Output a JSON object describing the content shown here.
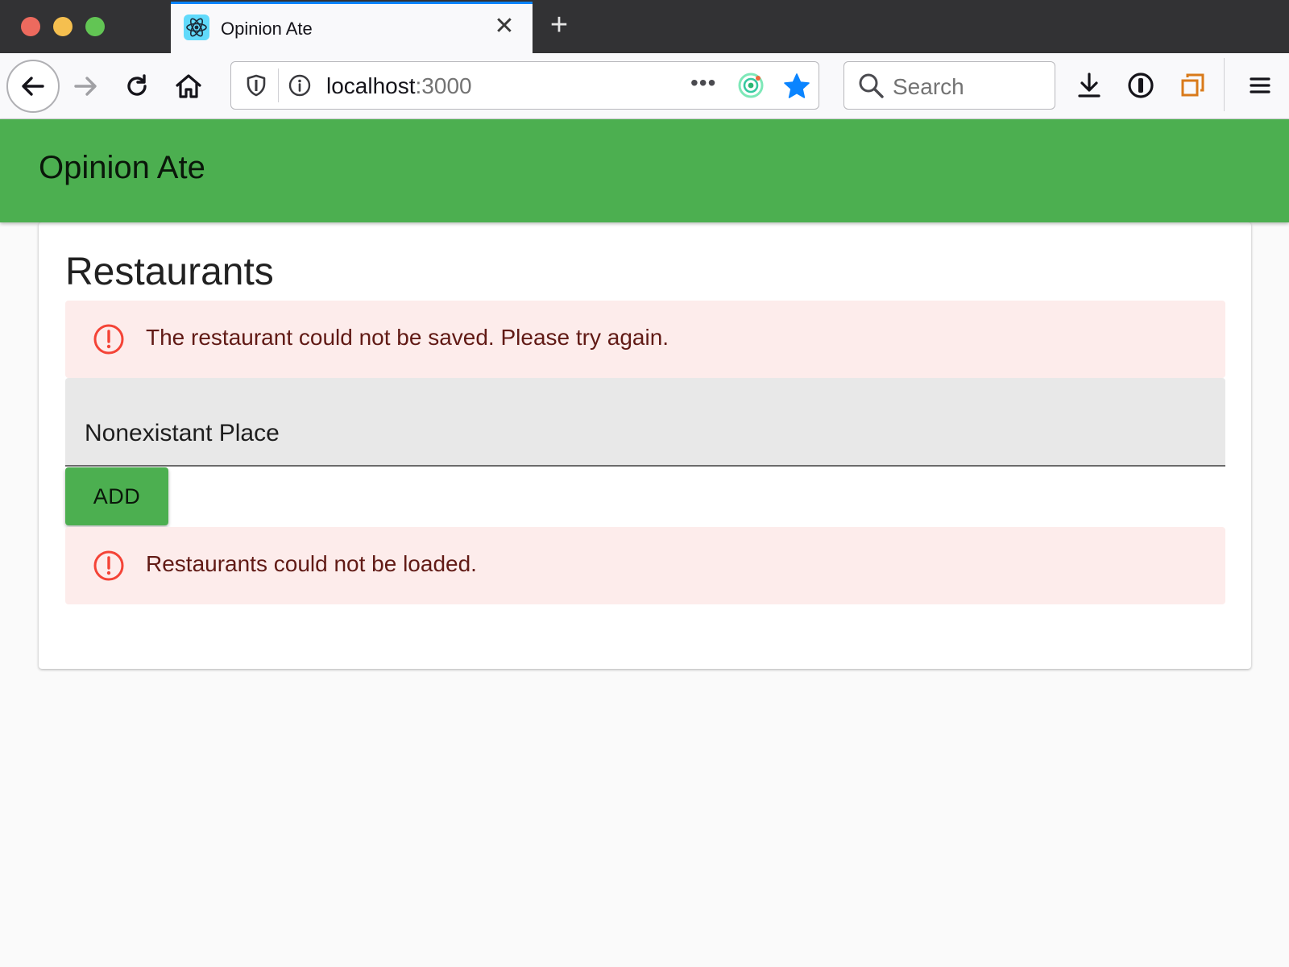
{
  "browser": {
    "tab": {
      "title": "Opinion Ate",
      "favicon": "react-atom-icon",
      "close_glyph": "✕"
    },
    "new_tab_glyph": "+",
    "url": {
      "host": "localhost",
      "port": ":3000"
    },
    "url_actions_glyph": "•••",
    "search_placeholder": "Search",
    "accent_color": "#0a84ff",
    "bookmark_star_color": "#0a84ff"
  },
  "app": {
    "title": "Opinion Ate",
    "brand_color": "#4caf50"
  },
  "restaurants": {
    "heading": "Restaurants",
    "save_error": "The restaurant could not be saved. Please try again.",
    "name_field_value": "Nonexistant Place",
    "add_button_label": "ADD",
    "load_error": "Restaurants could not be loaded.",
    "error_color": "#f44336",
    "error_background": "#fdeceb"
  }
}
